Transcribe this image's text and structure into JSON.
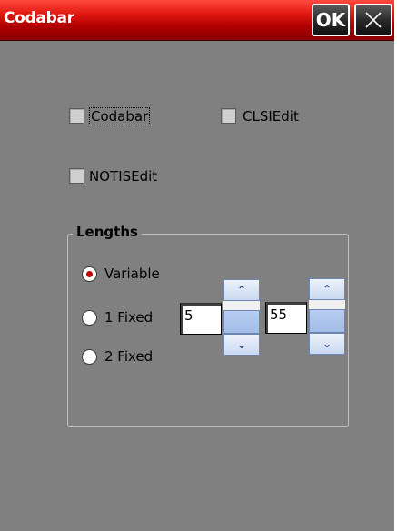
{
  "window": {
    "title": "Codabar",
    "ok_label": "OK",
    "close_icon": "close-icon"
  },
  "options": {
    "codabar": {
      "label": "Codabar",
      "checked": false
    },
    "clsiedit": {
      "label": "CLSIEdit",
      "checked": false
    },
    "notisedit": {
      "label": "NOTISEdit",
      "checked": false
    }
  },
  "lengths": {
    "title": "Lengths",
    "radios": [
      {
        "label": "Variable",
        "selected": true
      },
      {
        "label": "1 Fixed",
        "selected": false
      },
      {
        "label": "2 Fixed",
        "selected": false
      }
    ],
    "length1_value": "5",
    "length2_value": "55"
  },
  "colors": {
    "titlebar_red": "#c00000",
    "window_bg": "#808080",
    "radio_dot": "#c00000",
    "spinner_blue": "#c9d8f1"
  }
}
